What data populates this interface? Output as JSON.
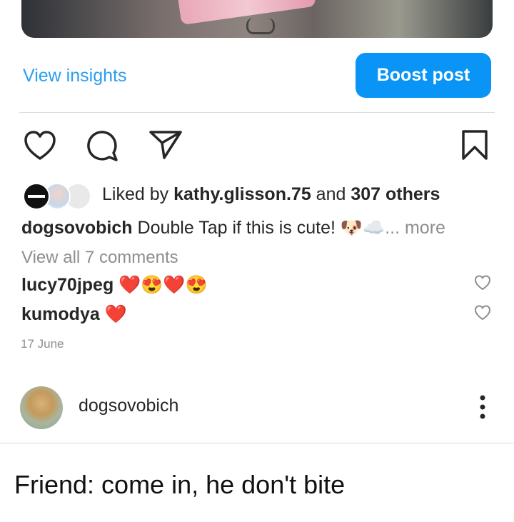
{
  "post_actions": {
    "insights_label": "View insights",
    "boost_label": "Boost post"
  },
  "likes": {
    "prefix": "Liked by ",
    "user": "kathy.glisson.75",
    "middle": " and ",
    "others": "307 others"
  },
  "caption": {
    "user": "dogsovobich",
    "text": " Double Tap if this is cute! 🐶☁️",
    "more": "... more"
  },
  "comments": {
    "view_all": "View all 7 comments",
    "items": [
      {
        "user": "lucy70jpeg",
        "text": " ❤️😍❤️😍"
      },
      {
        "user": "kumodya",
        "text": " ❤️"
      }
    ]
  },
  "date": "17 June",
  "next_post": {
    "user": "dogsovobich",
    "caption": "Friend: come in, he don't bite"
  },
  "colors": {
    "accent": "#0a95f6",
    "link": "#2a9ef0",
    "muted": "#8e8e8e",
    "text": "#262626"
  },
  "icons": [
    "heart-icon",
    "comment-icon",
    "share-icon",
    "bookmark-icon",
    "more-icon"
  ]
}
